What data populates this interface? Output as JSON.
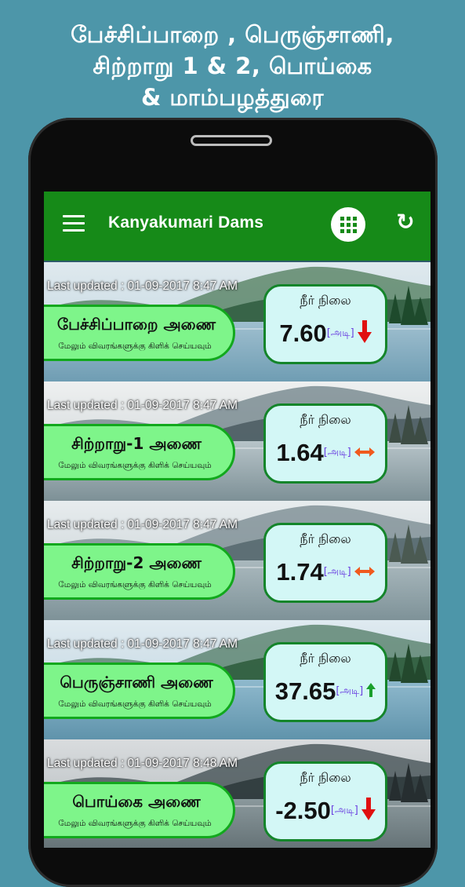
{
  "headline": {
    "line1": "பேச்சிப்பாறை , பெருஞ்சாணி,",
    "line2": "சிற்றாறு 1 & 2, பொய்கை",
    "line3": "& மாம்பழத்துரை"
  },
  "appbar": {
    "title": "Kanyakumari Dams",
    "menu_icon": "hamburger-menu-icon",
    "grid_icon": "grid-icon",
    "refresh_icon": "refresh-icon"
  },
  "cards": [
    {
      "updated": "Last updated : 01-09-2017 8:47 AM",
      "name": "பேச்சிப்பாறை அணை",
      "sub": "மேலும் விவரங்களுக்கு கிளிக் செய்யவும்",
      "label": "நீர் நிலை",
      "value": "7.60",
      "unit": "[அடி]",
      "trend": "down",
      "trend_color": "#e01010"
    },
    {
      "updated": "Last updated : 01-09-2017 8:47 AM",
      "name": "சிற்றாறு-1 அணை",
      "sub": "மேலும் விவரங்களுக்கு கிளிக் செய்யவும்",
      "label": "நீர் நிலை",
      "value": "1.64",
      "unit": "[அடி]",
      "trend": "steady",
      "trend_color": "#f05a1e"
    },
    {
      "updated": "Last updated : 01-09-2017 8:47 AM",
      "name": "சிற்றாறு-2 அணை",
      "sub": "மேலும் விவரங்களுக்கு கிளிக் செய்யவும்",
      "label": "நீர் நிலை",
      "value": "1.74",
      "unit": "[அடி]",
      "trend": "steady",
      "trend_color": "#f05a1e"
    },
    {
      "updated": "Last updated : 01-09-2017 8:47 AM",
      "name": "பெருஞ்சாணி அணை",
      "sub": "மேலும் விவரங்களுக்கு கிளிக் செய்யவும்",
      "label": "நீர் நிலை",
      "value": "37.65",
      "unit": "[அடி]",
      "trend": "up",
      "trend_color": "#19a02c"
    },
    {
      "updated": "Last updated : 01-09-2017 8:48 AM",
      "name": "பொய்கை அணை",
      "sub": "மேலும் விவரங்களுக்கு கிளிக் செய்யவும்",
      "label": "நீர் நிலை",
      "value": "-2.50",
      "unit": "[அடி]",
      "trend": "down",
      "trend_color": "#e01010"
    }
  ]
}
